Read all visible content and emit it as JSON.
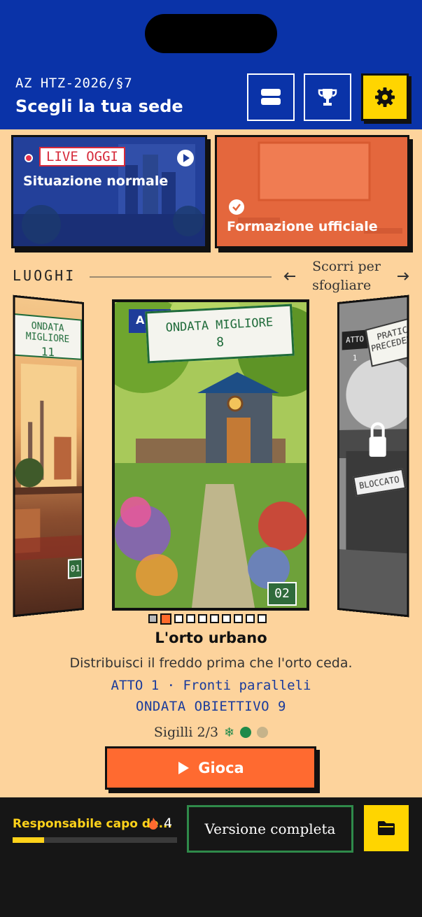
{
  "header": {
    "code": "AZ HTZ-2026/§7",
    "title": "Scegli la tua sede",
    "buttons": [
      {
        "icon": "layers-icon"
      },
      {
        "icon": "trophy-icon"
      },
      {
        "icon": "gear-icon"
      }
    ]
  },
  "cards": {
    "live": {
      "tag": "LIVE OGGI",
      "label": "Situazione normale"
    },
    "training": {
      "label": "Formazione ufficiale"
    }
  },
  "section": {
    "label": "LUOGHI",
    "scroll_hint_line1": "Scorri per",
    "scroll_hint_line2": "sfogliare"
  },
  "carousel": {
    "left": {
      "banner_line1": "ONDATA MIGLIORE",
      "banner_line2": "11",
      "number": "01"
    },
    "center": {
      "act_tag": "A",
      "banner_line1": "ONDATA MIGLIORE",
      "banner_line2": "8",
      "number": "02"
    },
    "right": {
      "act_tag": "ATTO 1",
      "banner_line1": "PRATICA",
      "banner_line2": "PRECEDENTE",
      "locked_label": "BLOCCATO"
    },
    "page_count": 10,
    "active_index": 1
  },
  "level": {
    "title": "L'orto urbano",
    "description": "Distribuisci il freddo prima che l'orto ceda.",
    "act": "ATTO 1 · Fronti paralleli",
    "goal": "ONDATA OBIETTIVO 9",
    "seals": "Sigilli 2/3",
    "play_label": "Gioca"
  },
  "footer": {
    "role": "Responsabile capo de...",
    "streak": "4",
    "progress": 0.19,
    "full_version": "Versione completa"
  },
  "colors": {
    "header_blue": "#0a33a8",
    "accent_yellow": "#ffd500",
    "play_orange": "#ff6a30",
    "background_beige": "#fdd39c",
    "footer_dark": "#161616"
  }
}
